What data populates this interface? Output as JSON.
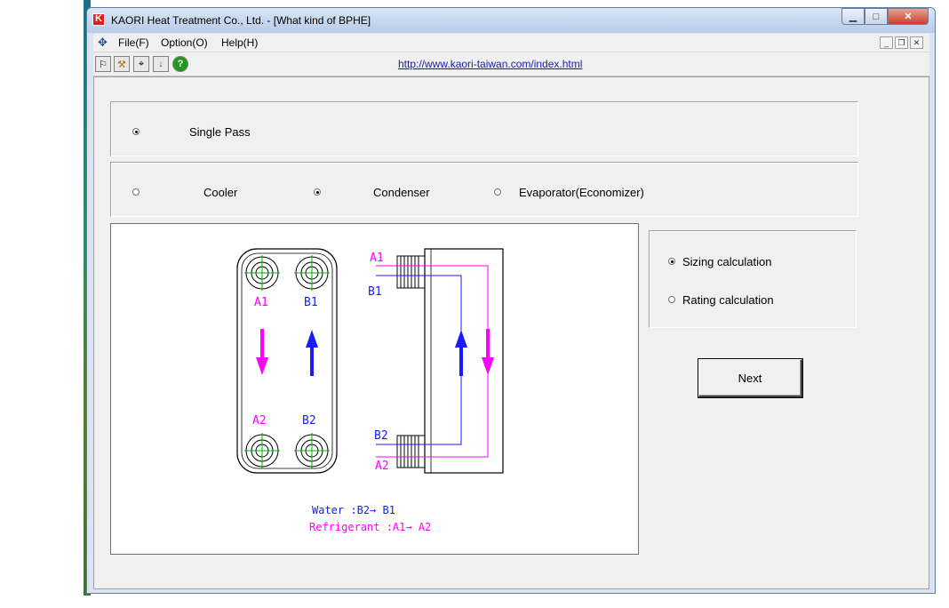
{
  "window": {
    "title": "KAORI Heat Treatment Co., Ltd. - [What kind of BPHE]"
  },
  "menu": {
    "items": [
      "File(F)",
      "Option(O)",
      "Help(H)"
    ]
  },
  "toolbar": {
    "link": "http://www.kaori-taiwan.com/index.html"
  },
  "pass_group": {
    "options": [
      {
        "label": "Single Pass",
        "selected": true
      }
    ]
  },
  "type_group": {
    "options": [
      {
        "label": "Cooler",
        "selected": false
      },
      {
        "label": "Condenser",
        "selected": true
      },
      {
        "label": "Evaporator(Economizer)",
        "selected": false
      }
    ]
  },
  "calc_group": {
    "options": [
      {
        "label": "Sizing calculation",
        "selected": true
      },
      {
        "label": "Rating calculation",
        "selected": false
      }
    ]
  },
  "diagram": {
    "port_labels": {
      "a1": "A1",
      "b1": "B1",
      "a2": "A2",
      "b2": "B2"
    },
    "water_flow": "Water :B2→ B1",
    "refrigerant_flow": "Refrigerant :A1→ A2",
    "colors": {
      "water": "#1a1aff",
      "refrigerant": "#ff00ff",
      "port_cross": "#00b000"
    }
  },
  "buttons": {
    "next": "Next"
  }
}
